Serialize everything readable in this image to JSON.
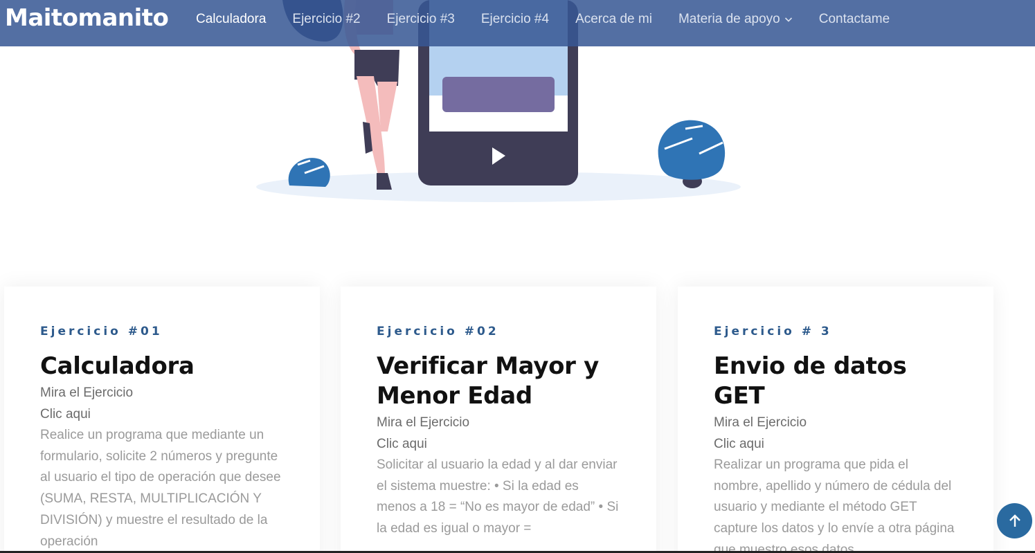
{
  "brand": "Maitomanito",
  "nav": {
    "items": [
      {
        "label": "Calculadora",
        "active": true
      },
      {
        "label": "Ejercicio #2",
        "active": false
      },
      {
        "label": "Ejercicio #3",
        "active": false
      },
      {
        "label": "Ejercicio #4",
        "active": false
      },
      {
        "label": "Acerca de mi",
        "active": false
      },
      {
        "label": "Materia de apoyo",
        "active": false,
        "dropdown": true
      },
      {
        "label": "Contactame",
        "active": false
      }
    ]
  },
  "cards": [
    {
      "label": "Ejercicio #01",
      "title": "Calculadora",
      "link1": "Mira el Ejercicio",
      "link2": "Clic aqui",
      "description": "Realice un programa que mediante un formulario, solicite 2 números y pregunte al usuario el tipo de operación que desee (SUMA, RESTA, MULTIPLICACIÓN Y DIVISIÓN) y muestre el resultado de la operación"
    },
    {
      "label": "Ejercicio #02",
      "title": "Verificar Mayor y Menor Edad",
      "link1": "Mira el Ejercicio",
      "link2": "Clic aqui",
      "description": "Solicitar al usuario la edad y al dar enviar el sistema muestre: • Si la edad es menos a 18 = “No es mayor de edad” • Si la edad es igual o mayor ="
    },
    {
      "label": "Ejercicio # 3",
      "title": "Envio de datos GET",
      "link1": "Mira el Ejercicio",
      "link2": "Clic aqui",
      "description": "Realizar un programa que pida el nombre, apellido y número de cédula del usuario y mediante el método GET capture los datos y lo envíe a otra página que muestro esos datos ."
    }
  ],
  "colors": {
    "navbar": "#375794",
    "accent": "#2d5a8c",
    "back_to_top": "#2a6aa0"
  },
  "icons": [
    "play-icon",
    "chevron-down-icon",
    "arrow-up-icon"
  ]
}
